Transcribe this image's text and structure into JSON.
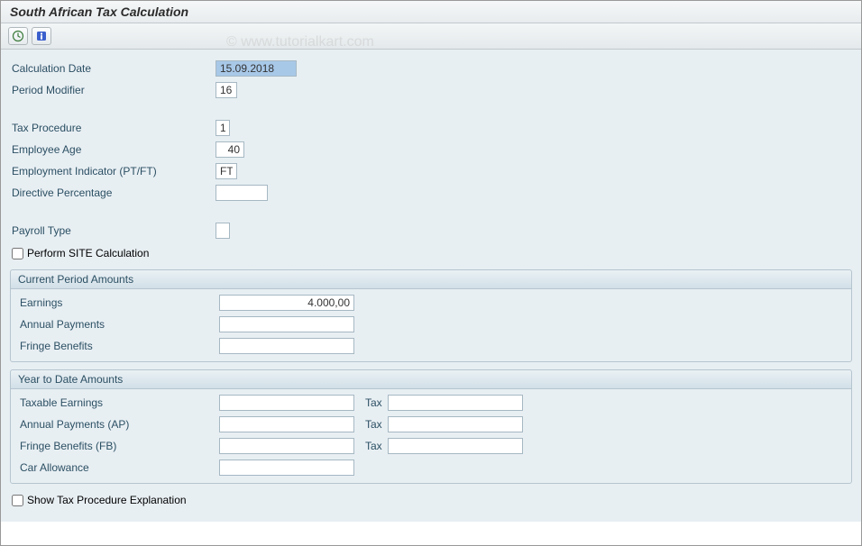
{
  "title": "South African Tax Calculation",
  "watermark": "© www.tutorialkart.com",
  "toolbar": {
    "execute_title": "Execute",
    "info_title": "Information"
  },
  "fields": {
    "calculation_date_label": "Calculation Date",
    "calculation_date_value": "15.09.2018",
    "period_modifier_label": "Period Modifier",
    "period_modifier_value": "16",
    "tax_procedure_label": "Tax Procedure",
    "tax_procedure_value": "1",
    "employee_age_label": "Employee Age",
    "employee_age_value": "40",
    "employment_indicator_label": "Employment Indicator (PT/FT)",
    "employment_indicator_value": "FT",
    "directive_percentage_label": "Directive Percentage",
    "directive_percentage_value": "",
    "payroll_type_label": "Payroll Type",
    "payroll_type_value": "",
    "perform_site_label": "Perform SITE Calculation",
    "show_explanation_label": "Show Tax Procedure Explanation"
  },
  "current_period": {
    "title": "Current Period Amounts",
    "earnings_label": "Earnings",
    "earnings_value": "4.000,00",
    "annual_payments_label": "Annual Payments",
    "annual_payments_value": "",
    "fringe_benefits_label": "Fringe Benefits",
    "fringe_benefits_value": ""
  },
  "ytd": {
    "title": "Year to Date Amounts",
    "tax_label": "Tax",
    "taxable_earnings_label": "Taxable Earnings",
    "taxable_earnings_value": "",
    "taxable_earnings_tax": "",
    "annual_payments_label": "Annual Payments (AP)",
    "annual_payments_value": "",
    "annual_payments_tax": "",
    "fringe_benefits_label": "Fringe Benefits (FB)",
    "fringe_benefits_value": "",
    "fringe_benefits_tax": "",
    "car_allowance_label": "Car Allowance",
    "car_allowance_value": ""
  }
}
